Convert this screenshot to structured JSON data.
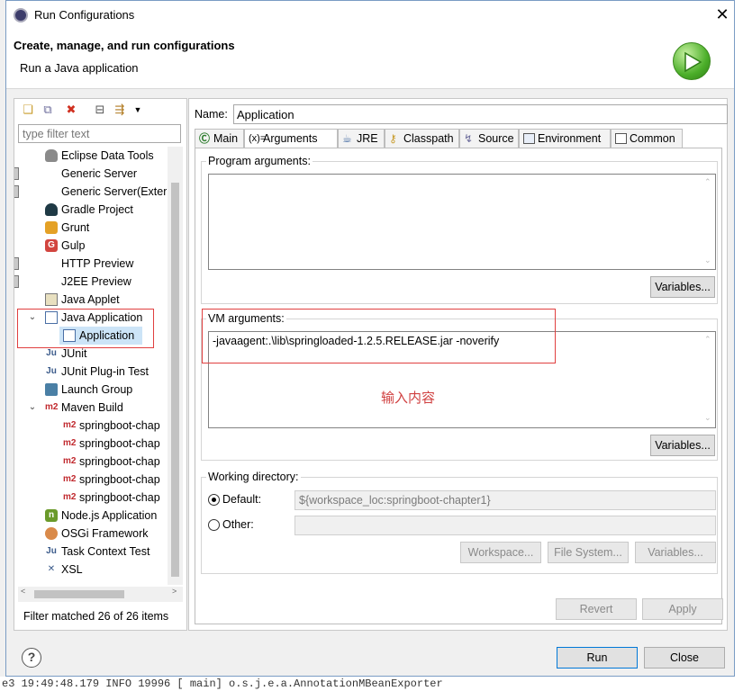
{
  "window": {
    "title": "Run Configurations"
  },
  "header": {
    "title": "Create, manage, and run configurations",
    "subtitle": "Run a Java application"
  },
  "left": {
    "filter_placeholder": "type filter text",
    "items": [
      {
        "label": "Eclipse Data Tools",
        "icon": "database-icon"
      },
      {
        "label": "Generic Server",
        "icon": "server-icon"
      },
      {
        "label": "Generic Server(Exter",
        "icon": "server-icon"
      },
      {
        "label": "Gradle Project",
        "icon": "gradle-icon"
      },
      {
        "label": "Grunt",
        "icon": "grunt-icon"
      },
      {
        "label": "Gulp",
        "icon": "gulp-icon"
      },
      {
        "label": "HTTP Preview",
        "icon": "server-icon"
      },
      {
        "label": "J2EE Preview",
        "icon": "server-icon"
      },
      {
        "label": "Java Applet",
        "icon": "applet-icon"
      },
      {
        "label": "Java Application",
        "icon": "java-app-icon"
      },
      {
        "label": "Application",
        "icon": "java-app-icon"
      },
      {
        "label": "JUnit",
        "icon": "junit-icon"
      },
      {
        "label": "JUnit Plug-in Test",
        "icon": "junit-icon"
      },
      {
        "label": "Launch Group",
        "icon": "launch-group-icon"
      },
      {
        "label": "Maven Build",
        "icon": "maven-icon"
      },
      {
        "label": "springboot-chap",
        "icon": "maven-icon"
      },
      {
        "label": "springboot-chap",
        "icon": "maven-icon"
      },
      {
        "label": "springboot-chap",
        "icon": "maven-icon"
      },
      {
        "label": "springboot-chap",
        "icon": "maven-icon"
      },
      {
        "label": "springboot-chap",
        "icon": "maven-icon"
      },
      {
        "label": "Node.js Application",
        "icon": "nodejs-icon"
      },
      {
        "label": "OSGi Framework",
        "icon": "osgi-icon"
      },
      {
        "label": "Task Context Test",
        "icon": "junit-icon"
      },
      {
        "label": "XSL",
        "icon": "xsl-icon"
      }
    ],
    "status": "Filter matched 26 of 26 items"
  },
  "config": {
    "name_label": "Name:",
    "name_value": "Application",
    "tabs": [
      {
        "label": "Main",
        "icon": "main-tab-icon"
      },
      {
        "label": "Arguments",
        "icon": "arguments-tab-icon"
      },
      {
        "label": "JRE",
        "icon": "jre-tab-icon"
      },
      {
        "label": "Classpath",
        "icon": "classpath-tab-icon"
      },
      {
        "label": "Source",
        "icon": "source-tab-icon"
      },
      {
        "label": "Environment",
        "icon": "environment-tab-icon"
      },
      {
        "label": "Common",
        "icon": "common-tab-icon"
      }
    ],
    "program_args_label": "Program arguments:",
    "program_args_value": "",
    "variables_label": "Variables...",
    "vm_args_label": "VM arguments:",
    "vm_args_value": "-javaagent:.\\lib\\springloaded-1.2.5.RELEASE.jar -noverify",
    "annotation": "输入内容",
    "working_dir_label": "Working directory:",
    "default_label": "Default:",
    "default_value": "${workspace_loc:springboot-chapter1}",
    "other_label": "Other:",
    "workspace_btn": "Workspace...",
    "filesystem_btn": "File System...",
    "revert_btn": "Revert",
    "apply_btn": "Apply"
  },
  "footer": {
    "run_btn": "Run",
    "close_btn": "Close"
  },
  "background": {
    "log_line": "e3 19:49:48.179  INFO 19996    [           main] o.s.j.e.a.AnnotationMBeanExporter"
  }
}
